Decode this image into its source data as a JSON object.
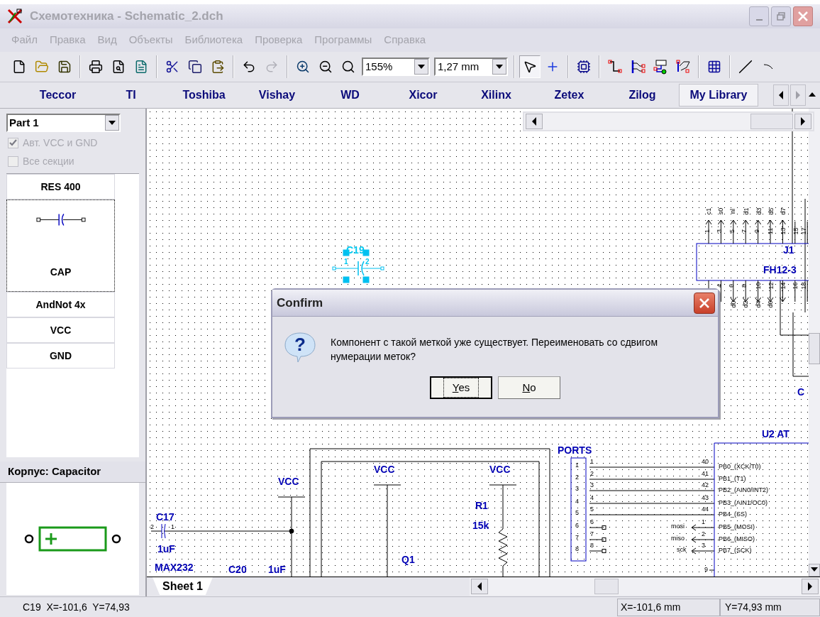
{
  "window": {
    "title": "Схемотехника - Schematic_2.dch",
    "active": false
  },
  "menu": [
    "Файл",
    "Правка",
    "Вид",
    "Объекты",
    "Библиотека",
    "Проверка",
    "Программы",
    "Справка"
  ],
  "toolbar": [
    {
      "kind": "new"
    },
    {
      "kind": "open"
    },
    {
      "kind": "save"
    },
    {
      "kind": "sep"
    },
    {
      "kind": "print"
    },
    {
      "kind": "preview"
    },
    {
      "kind": "report"
    },
    {
      "kind": "sep"
    },
    {
      "kind": "cut"
    },
    {
      "kind": "copy"
    },
    {
      "kind": "paste"
    },
    {
      "kind": "sep"
    },
    {
      "kind": "undo",
      "disabled": false
    },
    {
      "kind": "redo",
      "disabled": true
    },
    {
      "kind": "sep"
    },
    {
      "kind": "zoom_in"
    },
    {
      "kind": "zoom_out"
    },
    {
      "kind": "zoom_fit"
    },
    {
      "kind": "zoom_select",
      "value": "155%"
    },
    {
      "kind": "grid_select",
      "value": "1,27 mm"
    },
    {
      "kind": "sep"
    },
    {
      "kind": "pointer",
      "selected": true
    },
    {
      "kind": "cross",
      "selected": false
    },
    {
      "kind": "sep"
    },
    {
      "kind": "component",
      "selected": false
    },
    {
      "kind": "sep"
    },
    {
      "kind": "wire",
      "selected": false
    },
    {
      "kind": "bus",
      "selected": false
    },
    {
      "kind": "netport",
      "selected": false
    },
    {
      "kind": "netlabel",
      "selected": false
    },
    {
      "kind": "sep"
    },
    {
      "kind": "table",
      "selected": false
    },
    {
      "kind": "sep"
    },
    {
      "kind": "line",
      "selected": false
    },
    {
      "kind": "arc",
      "selected": false
    }
  ],
  "library_tabs": [
    {
      "label": "Teccor",
      "selected": false
    },
    {
      "label": "TI",
      "selected": false
    },
    {
      "label": "Toshiba",
      "selected": false
    },
    {
      "label": "Vishay",
      "selected": false
    },
    {
      "label": "WD",
      "selected": false
    },
    {
      "label": "Xicor",
      "selected": false
    },
    {
      "label": "Xilinx",
      "selected": false
    },
    {
      "label": "Zetex",
      "selected": false
    },
    {
      "label": "Zilog",
      "selected": false
    },
    {
      "label": "My Library",
      "selected": true
    }
  ],
  "tab_scroll": {
    "left_disabled": false,
    "right_disabled": true
  },
  "part_select": {
    "value": "Part 1"
  },
  "options": [
    {
      "label": "Авт. VCC и GND",
      "checked": true,
      "disabled": true
    },
    {
      "label": "Все секции",
      "checked": false,
      "disabled": true
    }
  ],
  "parts": [
    {
      "label": "RES 400",
      "selected": false
    },
    {
      "label": "CAP",
      "selected": true
    },
    {
      "label": "AndNot 4x",
      "selected": false
    },
    {
      "label": "VCC",
      "selected": false
    },
    {
      "label": "GND",
      "selected": false
    }
  ],
  "package": {
    "title": "Корпус: Capacitor"
  },
  "canvas": {
    "labels": [
      {
        "text": "C19",
        "kind": "selected"
      },
      {
        "text": "1",
        "kind": "selected_pin"
      },
      {
        "text": "2",
        "kind": "selected_pin"
      },
      {
        "text": "J1",
        "kind": "ref"
      },
      {
        "text": "FH12-3",
        "kind": "ref"
      },
      {
        "text": "c1",
        "kind": "pin_v"
      },
      {
        "text": "s0",
        "kind": "pin_v"
      },
      {
        "text": "nl",
        "kind": "pin_v"
      },
      {
        "text": "d1",
        "kind": "pin_v"
      },
      {
        "text": "d3",
        "kind": "pin_v"
      },
      {
        "text": "d5",
        "kind": "pin_v"
      },
      {
        "text": "d7",
        "kind": "pin_v"
      },
      {
        "text": "1",
        "kind": "pin_v"
      },
      {
        "text": "3",
        "kind": "pin_v"
      },
      {
        "text": "5",
        "kind": "pin_v"
      },
      {
        "text": "7",
        "kind": "pin_v"
      },
      {
        "text": "9",
        "kind": "pin_v"
      },
      {
        "text": "11",
        "kind": "pin_v"
      },
      {
        "text": "13",
        "kind": "pin_v"
      },
      {
        "text": "15",
        "kind": "pin_v"
      },
      {
        "text": "17",
        "kind": "pin_v"
      },
      {
        "text": "4",
        "kind": "pin_v"
      },
      {
        "text": "6",
        "kind": "pin_v"
      },
      {
        "text": "8",
        "kind": "pin_v"
      },
      {
        "text": "10",
        "kind": "pin_v"
      },
      {
        "text": "12",
        "kind": "pin_v"
      },
      {
        "text": "14",
        "kind": "pin_v"
      },
      {
        "text": "16",
        "kind": "pin_v"
      },
      {
        "text": "18",
        "kind": "pin_v"
      },
      {
        "text": "d0",
        "kind": "pin_v"
      },
      {
        "text": "d2",
        "kind": "pin_v"
      },
      {
        "text": "d4",
        "kind": "pin_v"
      },
      {
        "text": "d6",
        "kind": "pin_v"
      },
      {
        "text": "C",
        "kind": "ref"
      },
      {
        "text": "U2 AT",
        "kind": "ref"
      },
      {
        "text": "PORTS",
        "kind": "ref"
      },
      {
        "text": "1",
        "kind": "pin"
      },
      {
        "text": "2",
        "kind": "pin"
      },
      {
        "text": "3",
        "kind": "pin"
      },
      {
        "text": "4",
        "kind": "pin"
      },
      {
        "text": "5",
        "kind": "pin"
      },
      {
        "text": "6",
        "kind": "pin"
      },
      {
        "text": "7",
        "kind": "pin"
      },
      {
        "text": "8",
        "kind": "pin"
      },
      {
        "text": "1",
        "kind": "pin"
      },
      {
        "text": "2",
        "kind": "pin"
      },
      {
        "text": "3",
        "kind": "pin"
      },
      {
        "text": "4",
        "kind": "pin"
      },
      {
        "text": "5",
        "kind": "pin"
      },
      {
        "text": "6",
        "kind": "pin"
      },
      {
        "text": "7",
        "kind": "pin"
      },
      {
        "text": "8",
        "kind": "pin"
      },
      {
        "text": "40",
        "kind": "pin"
      },
      {
        "text": "41",
        "kind": "pin"
      },
      {
        "text": "42",
        "kind": "pin"
      },
      {
        "text": "43",
        "kind": "pin"
      },
      {
        "text": "44",
        "kind": "pin"
      },
      {
        "text": "1",
        "kind": "pin"
      },
      {
        "text": "2",
        "kind": "pin"
      },
      {
        "text": "3",
        "kind": "pin"
      },
      {
        "text": "mosi",
        "kind": "net"
      },
      {
        "text": "miso",
        "kind": "net"
      },
      {
        "text": "sck",
        "kind": "net"
      },
      {
        "text": "PB0_(XCK/T0)",
        "kind": "net"
      },
      {
        "text": "PB1_(T1)",
        "kind": "net"
      },
      {
        "text": "PB2_(AIN0/INT2)",
        "kind": "net"
      },
      {
        "text": "PB3_(AIN1/OC0)",
        "kind": "net"
      },
      {
        "text": "PB4_(SS)",
        "kind": "net"
      },
      {
        "text": "PB5_(MOSI)",
        "kind": "net"
      },
      {
        "text": "PB6_(MISO)",
        "kind": "net"
      },
      {
        "text": "PB7_(SCK)",
        "kind": "net"
      },
      {
        "text": "9",
        "kind": "pin"
      },
      {
        "text": "VCC",
        "kind": "ref"
      },
      {
        "text": "VCC",
        "kind": "ref"
      },
      {
        "text": "VCC",
        "kind": "ref"
      },
      {
        "text": "R1",
        "kind": "ref"
      },
      {
        "text": "15k",
        "kind": "ref"
      },
      {
        "text": "Q1",
        "kind": "ref"
      },
      {
        "text": "C17",
        "kind": "ref"
      },
      {
        "text": "2",
        "kind": "pin"
      },
      {
        "text": "1",
        "kind": "pin"
      },
      {
        "text": "1uF",
        "kind": "ref"
      },
      {
        "text": "MAX232",
        "kind": "ref"
      },
      {
        "text": "C20",
        "kind": "ref"
      },
      {
        "text": "1uF",
        "kind": "ref"
      }
    ]
  },
  "sheet_tabs": [
    {
      "label": "Sheet 1",
      "selected": true
    }
  ],
  "status": {
    "info": "C19  X=-101,6  Y=74,93",
    "x": "X=-101,6 mm",
    "y": "Y=74,93 mm"
  },
  "dialog": {
    "title": "Confirm",
    "icon_glyph": "?",
    "message": "Компонент с такой меткой уже существует. Переименовать со сдвигом нумерации меток?",
    "buttons": [
      {
        "key": "Y",
        "rest": "es",
        "default": true
      },
      {
        "key": "N",
        "rest": "o",
        "default": false
      }
    ]
  }
}
